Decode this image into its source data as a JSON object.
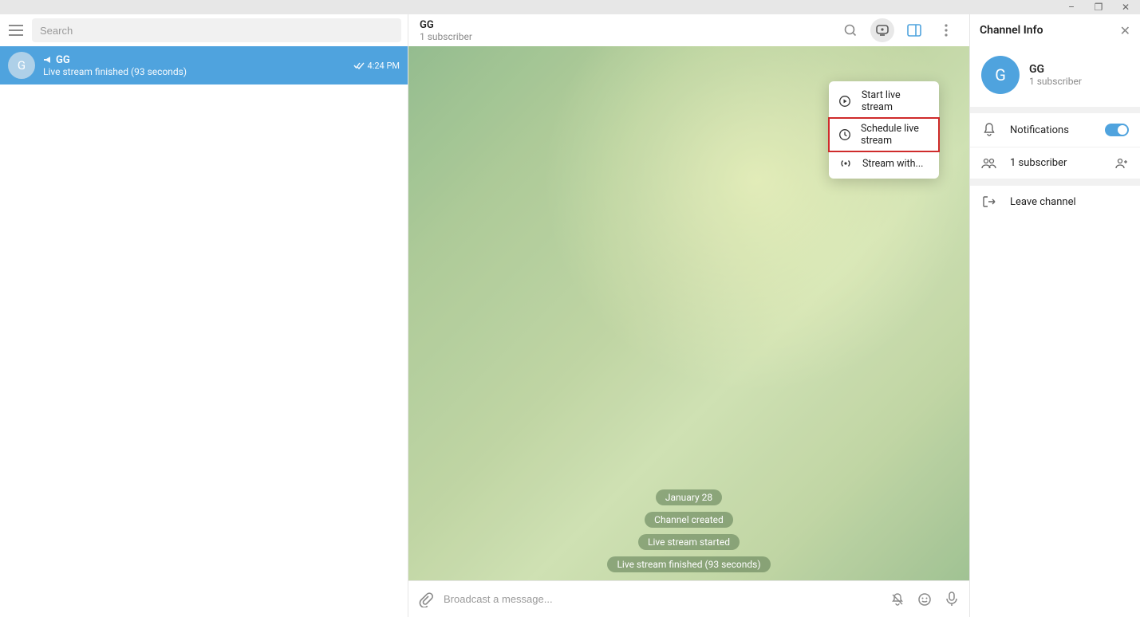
{
  "window_controls": {
    "min": "–",
    "max": "❐",
    "close": "✕"
  },
  "left": {
    "search_placeholder": "Search",
    "chat": {
      "avatar_letter": "G",
      "title": "GG",
      "subtitle": "Live stream finished (93 seconds)",
      "time": "4:24 PM"
    }
  },
  "center": {
    "header": {
      "title": "GG",
      "subtitle": "1 subscriber"
    },
    "dropdown": {
      "items": [
        {
          "label": "Start live stream"
        },
        {
          "label": "Schedule live stream",
          "highlight": true
        },
        {
          "label": "Stream with..."
        }
      ]
    },
    "messages": {
      "date": "January 28",
      "s1": "Channel created",
      "s2": "Live stream started",
      "s3": "Live stream finished (93 seconds)"
    },
    "compose_placeholder": "Broadcast a message..."
  },
  "right": {
    "header": "Channel Info",
    "profile": {
      "avatar_letter": "G",
      "name": "GG",
      "sub": "1 subscriber"
    },
    "notifications_label": "Notifications",
    "subscribers_label": "1 subscriber",
    "leave_label": "Leave channel"
  }
}
